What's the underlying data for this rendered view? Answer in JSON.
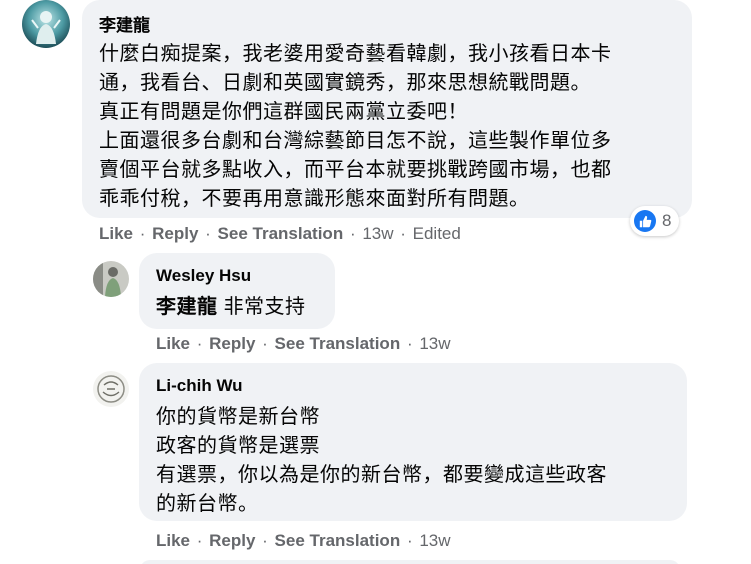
{
  "comments": [
    {
      "author": "李建龍",
      "avatar_icon": "profile-photo-icon",
      "lines": [
        "什麼白痴提案，我老婆用愛奇藝看韓劇，我小孩看日本卡",
        "通，我看台、日劇和英國實鏡秀，那來思想統戰問題。",
        "真正有問題是你們這群國民兩黨立委吧！",
        "上面還很多台劇和台灣綜藝節目怎不說，這些製作單位多",
        "賣個平台就多點收入，而平台本就要挑戰跨國市場，也都",
        "乖乖付稅，不要再用意識形態來面對所有問題。"
      ],
      "actions": {
        "like": "Like",
        "reply": "Reply",
        "translate": "See Translation",
        "time": "13w",
        "edited": "Edited"
      },
      "reaction_count": "8",
      "reaction_icon": "like-icon"
    },
    {
      "author": "Wesley Hsu",
      "avatar_icon": "profile-photo-icon",
      "mention": "李建龍",
      "text": "非常支持",
      "actions": {
        "like": "Like",
        "reply": "Reply",
        "translate": "See Translation",
        "time": "13w"
      }
    },
    {
      "author": "Li-chih Wu",
      "avatar_icon": "profile-photo-icon",
      "lines": [
        "你的貨幣是新台幣",
        "政客的貨幣是選票",
        "有選票，你以為是你的新台幣，都要變成這些政客",
        "的新台幣。"
      ],
      "actions": {
        "like": "Like",
        "reply": "Reply",
        "translate": "See Translation",
        "time": "13w"
      }
    }
  ],
  "colors": {
    "bubble": "#f0f2f5",
    "meta_text": "#65676b",
    "like_blue": "#1877f2"
  }
}
